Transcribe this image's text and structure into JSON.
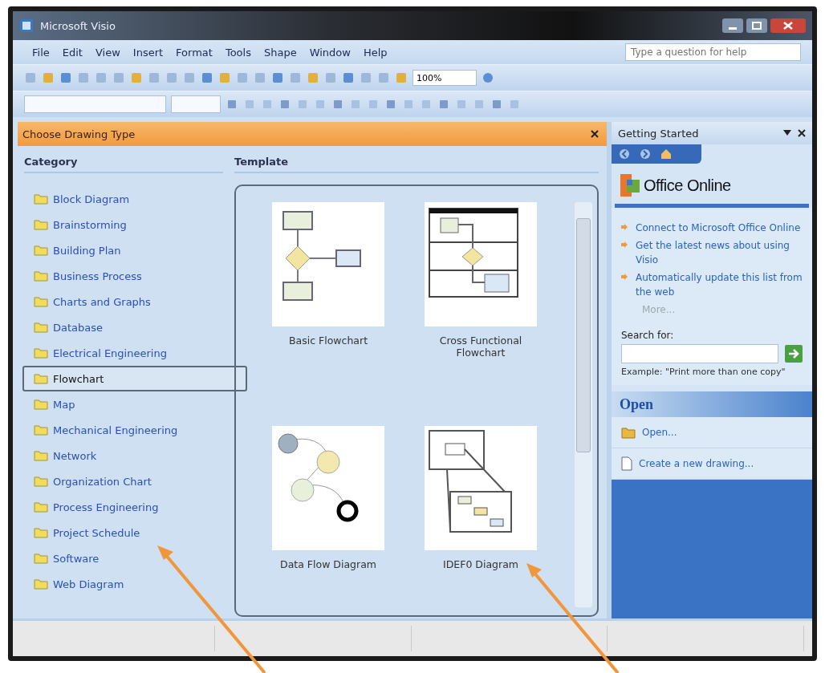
{
  "window": {
    "title": "Microsoft Visio"
  },
  "menu": [
    "File",
    "Edit",
    "View",
    "Insert",
    "Format",
    "Tools",
    "Shape",
    "Window",
    "Help"
  ],
  "help_box": {
    "placeholder": "Type a question for help"
  },
  "zoom_box": {
    "value": "100%"
  },
  "drawing_type_panel": {
    "title": "Choose Drawing Type",
    "category_heading": "Category",
    "categories": [
      {
        "label": "Block Diagram",
        "selected": false
      },
      {
        "label": "Brainstorming",
        "selected": false
      },
      {
        "label": "Building Plan",
        "selected": false
      },
      {
        "label": "Business Process",
        "selected": false
      },
      {
        "label": "Charts and Graphs",
        "selected": false
      },
      {
        "label": "Database",
        "selected": false
      },
      {
        "label": "Electrical Engineering",
        "selected": false
      },
      {
        "label": "Flowchart",
        "selected": true
      },
      {
        "label": "Map",
        "selected": false
      },
      {
        "label": "Mechanical Engineering",
        "selected": false
      },
      {
        "label": "Network",
        "selected": false
      },
      {
        "label": "Organization Chart",
        "selected": false
      },
      {
        "label": "Process Engineering",
        "selected": false
      },
      {
        "label": "Project Schedule",
        "selected": false
      },
      {
        "label": "Software",
        "selected": false
      },
      {
        "label": "Web Diagram",
        "selected": false
      }
    ],
    "template_heading": "Template",
    "templates": [
      {
        "label": "Basic Flowchart",
        "kind": "flowchart"
      },
      {
        "label": "Cross Functional Flowchart",
        "kind": "swimlane"
      },
      {
        "label": "Data Flow Diagram",
        "kind": "dataflow"
      },
      {
        "label": "IDEF0 Diagram",
        "kind": "idef0"
      }
    ]
  },
  "getting_started_pane": {
    "title": "Getting Started",
    "logo": "Office Online",
    "links": [
      "Connect to Microsoft Office Online",
      "Get the latest news about using Visio",
      "Automatically update this list from the web"
    ],
    "more": "More...",
    "search_label": "Search for:",
    "example": "Example:  \"Print more than one copy\"",
    "open_heading": "Open",
    "open_items": [
      {
        "label": "Open...",
        "kind": "folder"
      },
      {
        "label": "Create a new drawing...",
        "kind": "document"
      }
    ]
  }
}
